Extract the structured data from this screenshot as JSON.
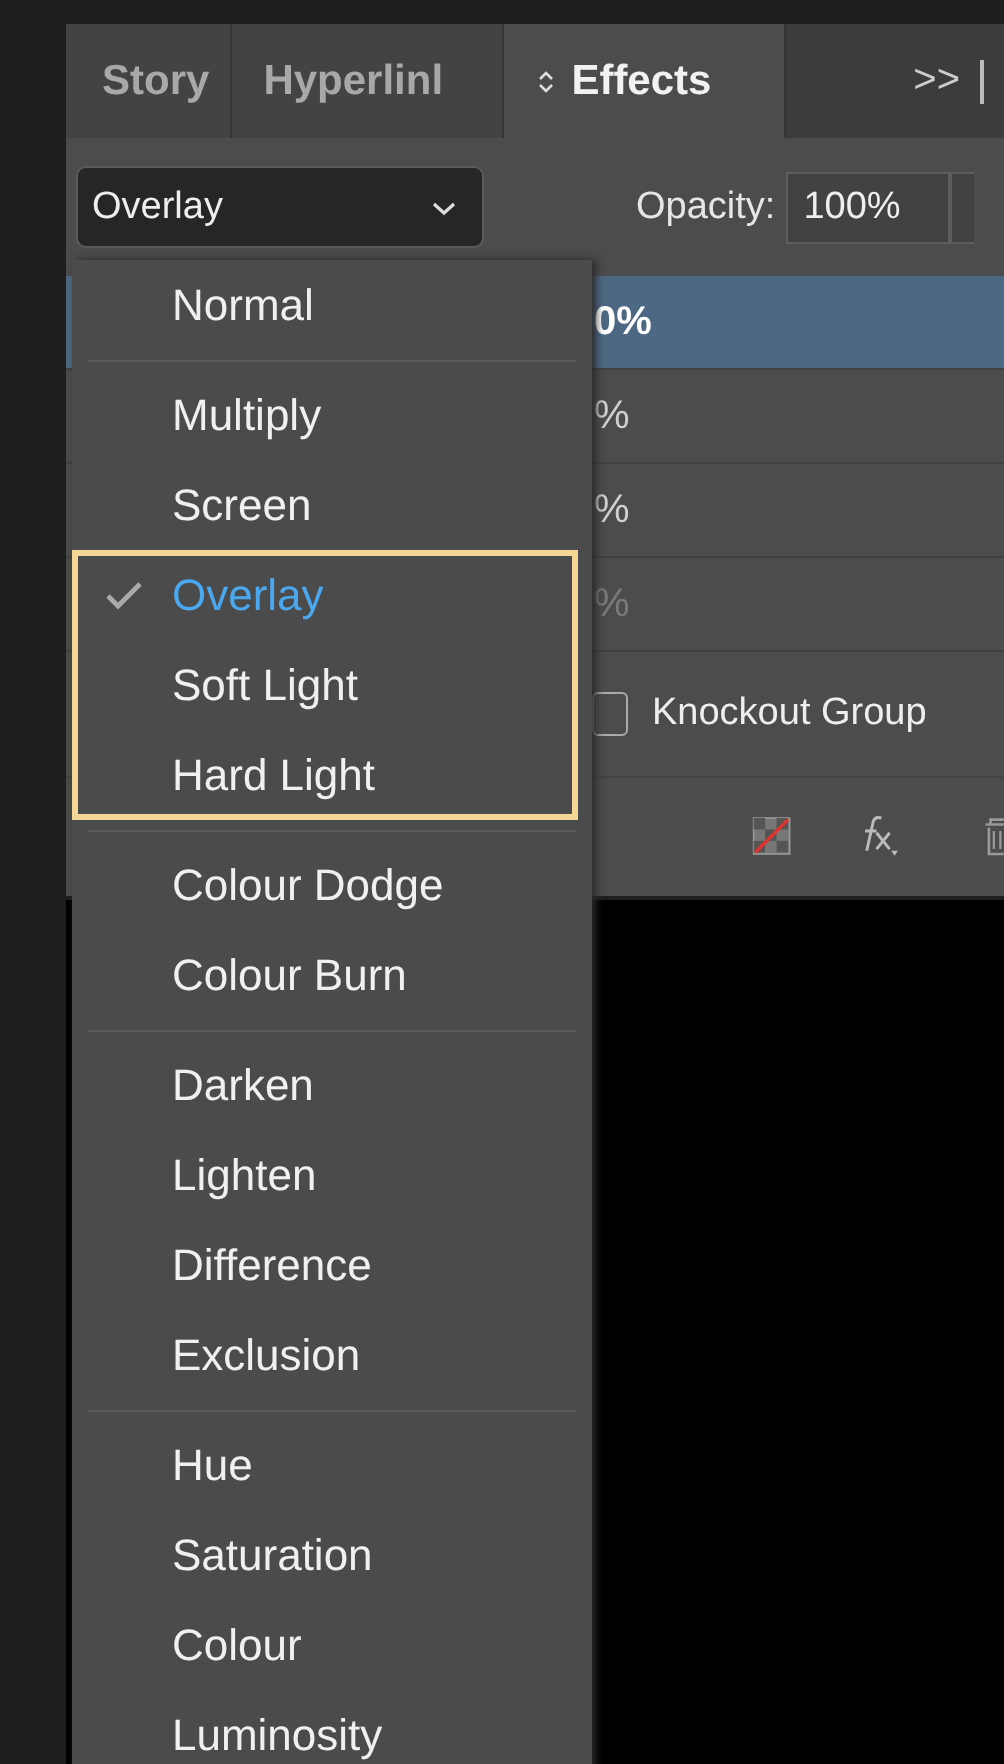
{
  "tabs": [
    {
      "label": "Story",
      "selected": false,
      "stepper": false
    },
    {
      "label": "Hyperlinl",
      "selected": false,
      "stepper": false
    },
    {
      "label": "Effects",
      "selected": true,
      "stepper": true
    }
  ],
  "overflow_button": ">>",
  "blend_mode": {
    "value": "Overlay"
  },
  "opacity": {
    "label": "Opacity:",
    "value": "100%"
  },
  "layer_rows": [
    {
      "value": "0%",
      "selected": true,
      "disabled": false
    },
    {
      "value": "%",
      "selected": false,
      "disabled": false
    },
    {
      "value": "%",
      "selected": false,
      "disabled": false
    },
    {
      "value": "%",
      "selected": false,
      "disabled": true
    }
  ],
  "knockout": {
    "label": "Knockout Group",
    "checked": false
  },
  "blend_menu": {
    "groups": [
      {
        "items": [
          {
            "label": "Normal",
            "checked": false,
            "highlighted": false
          }
        ]
      },
      {
        "items": [
          {
            "label": "Multiply",
            "checked": false,
            "highlighted": false
          },
          {
            "label": "Screen",
            "checked": false,
            "highlighted": false
          },
          {
            "label": "Overlay",
            "checked": true,
            "highlighted": true
          },
          {
            "label": "Soft Light",
            "checked": false,
            "highlighted": true
          },
          {
            "label": "Hard Light",
            "checked": false,
            "highlighted": true
          }
        ]
      },
      {
        "items": [
          {
            "label": "Colour Dodge",
            "checked": false,
            "highlighted": false
          },
          {
            "label": "Colour Burn",
            "checked": false,
            "highlighted": false
          }
        ]
      },
      {
        "items": [
          {
            "label": "Darken",
            "checked": false,
            "highlighted": false
          },
          {
            "label": "Lighten",
            "checked": false,
            "highlighted": false
          },
          {
            "label": "Difference",
            "checked": false,
            "highlighted": false
          },
          {
            "label": "Exclusion",
            "checked": false,
            "highlighted": false
          }
        ]
      },
      {
        "items": [
          {
            "label": "Hue",
            "checked": false,
            "highlighted": false
          },
          {
            "label": "Saturation",
            "checked": false,
            "highlighted": false
          },
          {
            "label": "Colour",
            "checked": false,
            "highlighted": false
          },
          {
            "label": "Luminosity",
            "checked": false,
            "highlighted": false
          }
        ]
      }
    ]
  }
}
